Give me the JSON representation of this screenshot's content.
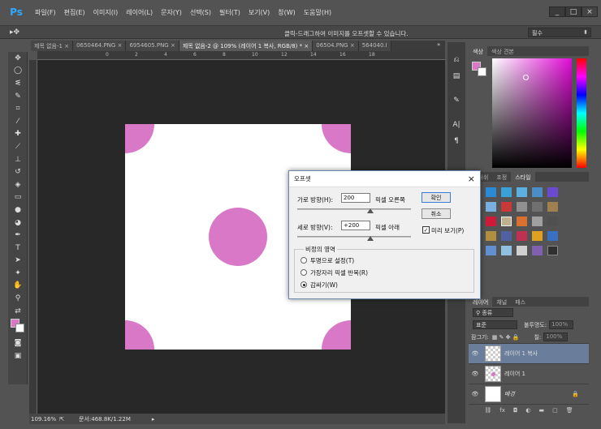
{
  "app": {
    "logo": "Ps",
    "accent": "#31a8ff"
  },
  "menu": [
    "파일(F)",
    "편집(E)",
    "이미지(I)",
    "레이어(L)",
    "문자(Y)",
    "선택(S)",
    "필터(T)",
    "보기(V)",
    "창(W)",
    "도움말(H)"
  ],
  "window_controls": {
    "minimize": "_",
    "maximize": "□",
    "close": "×"
  },
  "options_bar": {
    "hint": "클릭-드래그하여 이미지를 오프셋할 수 있습니다.",
    "workspace": "필수"
  },
  "doc_tabs": [
    {
      "label": "제목 없음-1",
      "active": false
    },
    {
      "label": "0650464.PNG",
      "active": false
    },
    {
      "label": "6954605.PNG",
      "active": false
    },
    {
      "label": "제목 없음-2 @ 109% (레이어 1 복사, RGB/8) *",
      "active": true
    },
    {
      "label": "06504.PNG",
      "active": false
    },
    {
      "label": "564040.I",
      "active": false
    }
  ],
  "ruler_top": [
    "0",
    "2",
    "4",
    "6",
    "8",
    "10",
    "12",
    "14",
    "16",
    "18"
  ],
  "status": {
    "zoom": "109.16%",
    "doc": "문서:468.8K/1.22M"
  },
  "colors": {
    "foreground": "#d878c6",
    "background": "#ffffff",
    "circle": "#d878c6"
  },
  "color_panel": {
    "tabs": [
      "색상",
      "색상 견본"
    ]
  },
  "adj_panel": {
    "tabs": [
      "브러쉬",
      "조정",
      "스타일"
    ]
  },
  "layers_panel": {
    "tabs": [
      "레이어",
      "채널",
      "패스"
    ],
    "kind": "종류",
    "blend_mode": "표준",
    "opacity_label": "불투명도:",
    "opacity": "100%",
    "lock_label": "잠그기:",
    "fill_label": "칠:",
    "fill": "100%",
    "layers": [
      {
        "name": "레이어 1 복사",
        "selected": true
      },
      {
        "name": "레이어 1",
        "selected": false
      },
      {
        "name": "배경",
        "selected": false
      }
    ]
  },
  "dialog": {
    "title": "오프셋",
    "close": "×",
    "horizontal_label": "가로 방향(H):",
    "horizontal_value": "200",
    "horizontal_unit": "픽셀 오른쪽",
    "vertical_label": "세로 방향(V):",
    "vertical_value": "+200",
    "vertical_unit": "픽셀 아래",
    "ok": "확인",
    "cancel": "취소",
    "preview_label": "미리 보기(P)",
    "undefined_area": "비정의 영역",
    "options": [
      {
        "label": "투명으로 설정(T)",
        "selected": false
      },
      {
        "label": "가장자리 픽셀 반복(R)",
        "selected": false
      },
      {
        "label": "감싸기(W)",
        "selected": true
      }
    ]
  }
}
